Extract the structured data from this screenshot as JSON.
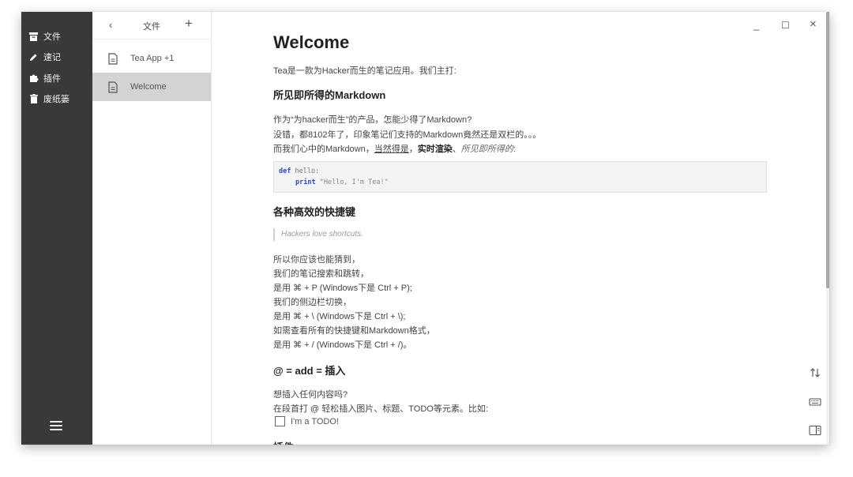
{
  "sidebar": {
    "items": [
      {
        "label": "文件",
        "icon": "archive-icon"
      },
      {
        "label": "速记",
        "icon": "pencil-icon"
      },
      {
        "label": "插件",
        "icon": "puzzle-icon"
      },
      {
        "label": "废纸篓",
        "icon": "trash-icon"
      }
    ],
    "menu_icon": "hamburger-menu-icon"
  },
  "files_panel": {
    "back": "‹",
    "title": "文件",
    "add": "+",
    "items": [
      {
        "name": "Tea App +1",
        "active": false
      },
      {
        "name": "Welcome",
        "active": true
      }
    ]
  },
  "window_controls": {
    "minimize": "_",
    "maximize": "☐",
    "close": "×"
  },
  "doc": {
    "title": "Welcome",
    "intro": "Tea是一款为Hacker而生的笔记应用。我们主打:",
    "h_markdown": "所见即所得的Markdown",
    "p1_line1": "作为“为hacker而生”的产品，怎能少得了Markdown?",
    "p1_line2": "没错，都8102年了，印象笔记们支持的Markdown竟然还是双栏的。。。",
    "p1_line3_a": "而我们心中的Markdown，",
    "p1_line3_u": "当然得是",
    "p1_line3_b": "，",
    "p1_line3_strong": "实时渲染",
    "p1_line3_c": "、",
    "p1_line3_em": "所见即所得的",
    "p1_line3_d": ":",
    "code": {
      "line1_kw": "def",
      "line1_rest": " hello:",
      "line2_kw": "print",
      "line2_str": " \"Hello, I'm Tea!\""
    },
    "h_shortcuts": "各种高效的快捷键",
    "quote": "Hackers love shortcuts.",
    "shortcut_lines": [
      "所以你应该也能猜到，",
      "我们的笔记搜索和跳转，",
      "是用 ⌘ + P (Windows下是 Ctrl + P);",
      "我们的侧边栏切换，",
      "是用 ⌘ + \\ (Windows下是 Ctrl + \\);",
      "如需查看所有的快捷键和Markdown格式，",
      "是用 ⌘ + / (Windows下是 Ctrl + /)。"
    ],
    "h_insert": "@ = add = 插入",
    "insert_line1": "想插入任何内容吗?",
    "insert_line2": "在段首打 @ 轻松插入图片、标题、TODO等元素。比如:",
    "todo": "I'm a TODO!",
    "next_heading": "插件"
  },
  "tools": [
    {
      "icon": "sort-arrows-icon"
    },
    {
      "icon": "keyboard-icon"
    },
    {
      "icon": "sidebar-toggle-icon"
    }
  ]
}
